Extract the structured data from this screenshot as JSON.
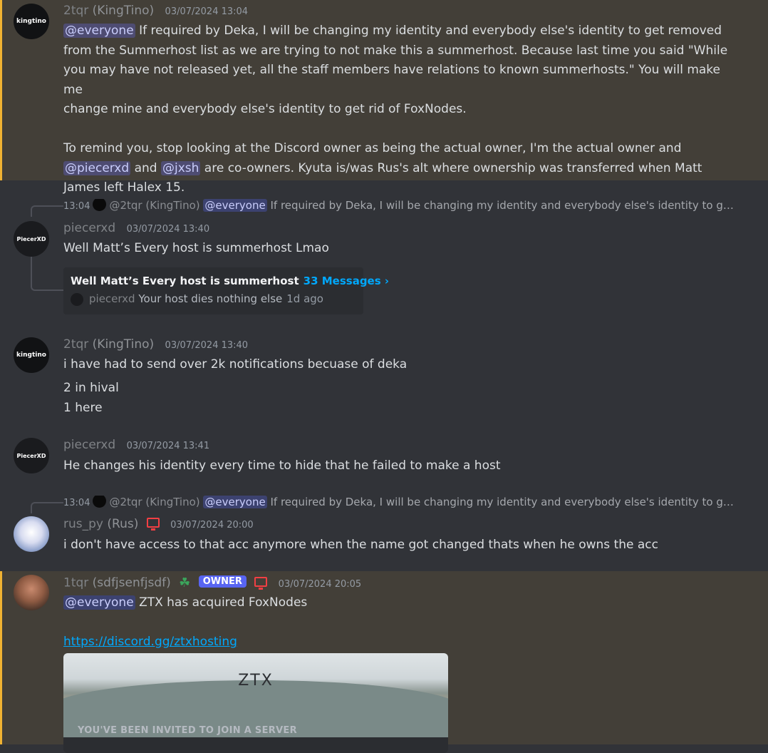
{
  "messages": [
    {
      "user": "2tqr",
      "nick": "(KingTino)",
      "time": "03/07/2024 13:04",
      "avatar_text": "kingtino",
      "mention": "@everyone",
      "line1": "If required by Deka, I will be changing my identity and everybody else's identity to get removed",
      "line2": "from the Summerhost list as we are trying to not make this a summerhost. Because last time you said \"While",
      "line3": "you may have not released yet, all the staff members have relations to known summerhosts.\" You will make me",
      "line4": "change mine and everybody else's identity to get rid of FoxNodes.",
      "line5": "To remind you, stop looking at the Discord owner as being the actual owner, I'm the actual owner and",
      "mention_piecerxd": "@piecerxd",
      "and": "and",
      "mention_jxsh": "@jxsh",
      "line6_rest": "are co-owners. Kyuta is/was Rus's alt where ownership was transferred when Matt",
      "line7": "James left Halex 15."
    },
    {
      "reply_time": "13:04",
      "reply_user": "@2tqr (KingTino)",
      "reply_mention": "@everyone",
      "reply_text": "If required by Deka, I will be changing my identity and everybody else's identity to get r…",
      "user": "piecerxd",
      "time": "03/07/2024 13:40",
      "avatar_text": "PiecerXD",
      "text": "Well Matt’s Every host is summerhost Lmao",
      "thread_title": "Well Matt’s Every host is summerhost",
      "thread_count": "33 Messages ›",
      "thread_last_user": "piecerxd",
      "thread_last_text": "Your host dies nothing else",
      "thread_last_time": "1d ago"
    },
    {
      "user": "2tqr",
      "nick": "(KingTino)",
      "time": "03/07/2024 13:40",
      "avatar_text": "kingtino",
      "text1": "i have had to send over 2k notifications becuase of deka",
      "text2": "2 in hival",
      "text3": "1 here"
    },
    {
      "user": "piecerxd",
      "time": "03/07/2024 13:41",
      "avatar_text": "PiecerXD",
      "text": "He changes his identity every time to hide that he failed to make a host"
    },
    {
      "reply_time": "13:04",
      "reply_user": "@2tqr (KingTino)",
      "reply_mention": "@everyone",
      "reply_text": "If required by Deka, I will be changing my identity and everybody else's identity to get r…",
      "user": "rus_py",
      "nick": "(Rus)",
      "time": "03/07/2024 20:00",
      "text": "i don't have access to that acc anymore when the name got changed thats when he owns the acc"
    },
    {
      "user": "1tqr",
      "nick": "(sdfjsenfjsdf)",
      "badge": "OWNER",
      "time": "03/07/2024 20:05",
      "mention": "@everyone",
      "text": "ZTX has acquired FoxNodes",
      "link": "https://discord.gg/ztxhosting",
      "invite_banner": "ZTX",
      "invite_label": "YOU'VE BEEN INVITED TO JOIN A SERVER"
    }
  ],
  "colors": {
    "background": "#313338",
    "highlight": "#433f38",
    "highlight_bar": "#f0b232",
    "mention": "#c9cdfb",
    "link": "#00a8fc",
    "owner_badge": "#5865f2"
  }
}
